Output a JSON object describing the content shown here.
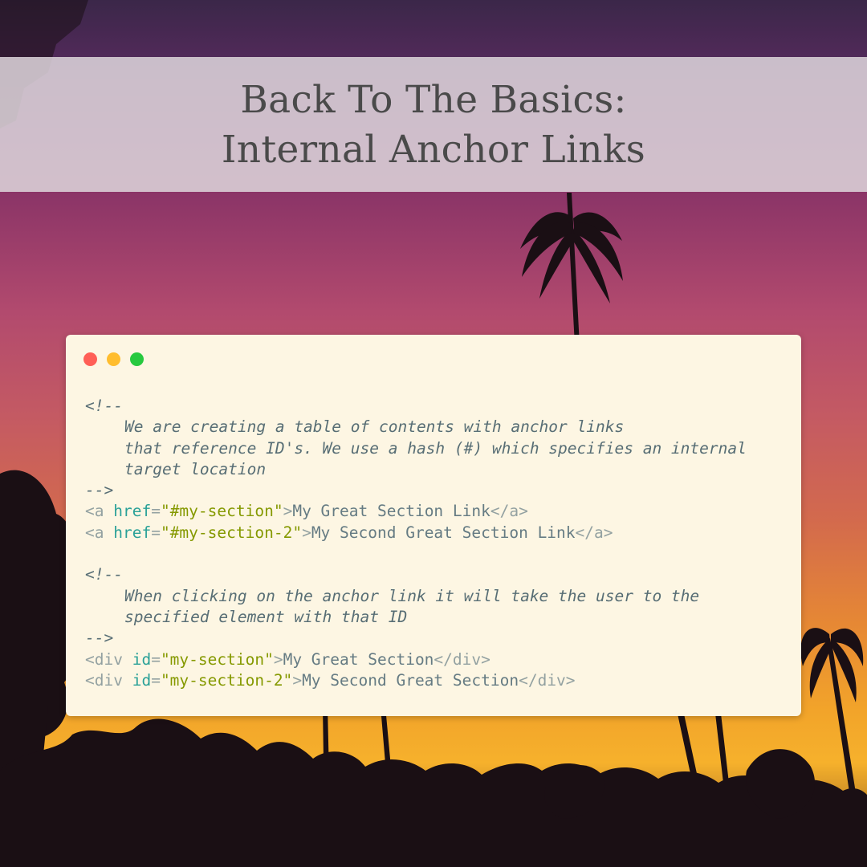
{
  "title": {
    "line1": "Back To The Basics:",
    "line2": "Internal Anchor Links"
  },
  "code": {
    "comment_open": "<!--",
    "comment_close": "-->",
    "comment1": [
      "We are creating a table of contents with anchor links",
      "that reference ID's. We use a hash (#) which specifies an internal",
      "target location"
    ],
    "links": [
      {
        "open": "<a ",
        "attr": "href",
        "eq": "=",
        "value": "\"#my-section\"",
        "close": ">",
        "text": "My Great Section Link",
        "end": "</a>"
      },
      {
        "open": "<a ",
        "attr": "href",
        "eq": "=",
        "value": "\"#my-section-2\"",
        "close": ">",
        "text": "My Second Great Section Link",
        "end": "</a>"
      }
    ],
    "comment2": [
      "When clicking on the anchor link it will take the user to the",
      "specified element with that ID"
    ],
    "divs": [
      {
        "open": "<div ",
        "attr": "id",
        "eq": "=",
        "value": "\"my-section\"",
        "close": ">",
        "text": "My Great Section",
        "end": "</div>"
      },
      {
        "open": "<div ",
        "attr": "id",
        "eq": "=",
        "value": "\"my-section-2\"",
        "close": ">",
        "text": "My Second Great Section",
        "end": "</div>"
      }
    ]
  },
  "colors": {
    "window_bg": "#fdf6e3",
    "dot_red": "#ff5f56",
    "dot_yellow": "#ffbd2e",
    "dot_green": "#27c93f",
    "attr": "#2aa198",
    "string": "#859900"
  }
}
